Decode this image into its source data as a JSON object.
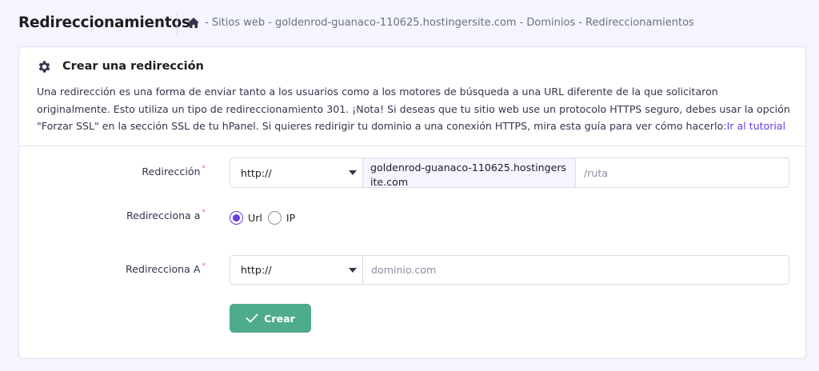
{
  "header": {
    "title": "Redireccionamientos",
    "breadcrumb": [
      "- Sitios web",
      "- goldenrod-guanaco-110625.hostingersite.com",
      "- Dominios",
      "- Redireccionamientos"
    ]
  },
  "card": {
    "title": "Crear una redirección",
    "description": "Una redirección es una forma de enviar tanto a los usuarios como a los motores de búsqueda a una URL diferente de la que solicitaron originalmente. Esto utiliza un tipo de redireccionamiento 301. ¡Nota! Si deseas que tu sitio web use un protocolo HTTPS seguro, debes usar la opción \"Forzar SSL\" en la sección SSL de tu hPanel. Si quieres redirigir tu dominio a una conexión HTTPS, mira esta guía para ver cómo hacerlo:",
    "tutorial_link": "Ir al tutorial"
  },
  "form": {
    "redirect_label": "Redirección",
    "redirect_protocol": "http://",
    "redirect_domain": "goldenrod-guanaco-110625.hostingersite.com",
    "path_placeholder": "/ruta",
    "redirect_to_label": "Redirecciona a",
    "radio_url": "Url",
    "radio_ip": "IP",
    "target_label": "Redirecciona A",
    "target_protocol": "http://",
    "target_placeholder": "dominio.com",
    "required_mark": "*",
    "submit_label": "Crear"
  },
  "colors": {
    "accent": "#673de6",
    "success": "#4eac8a"
  }
}
